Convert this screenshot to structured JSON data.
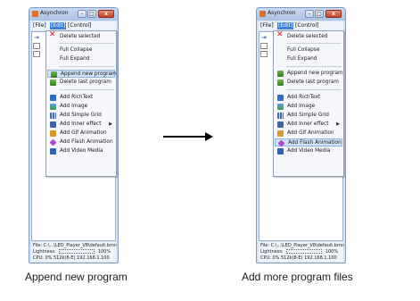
{
  "windows": [
    {
      "title": "Asynchron",
      "menu": {
        "file": "[File]",
        "edit": "[Edit]",
        "control": "[Control]"
      },
      "highlighted_item": "Append new program",
      "status": {
        "file_label": "File:",
        "file_path": "C:\\...\\LED_Player_V8\\default.bmn",
        "lightness_label": "Lightness:",
        "lightness_value": "100%",
        "cpu_label": "CPU:",
        "cpu_value": "0%",
        "mem": "512k(8-E)",
        "ip": "192.168.1.100"
      }
    },
    {
      "title": "Asynchron",
      "menu": {
        "file": "[File]",
        "edit": "[Edit]",
        "control": "[Control]"
      },
      "highlighted_item": "Add Flash Animation",
      "status": {
        "file_label": "File:",
        "file_path": "C:\\...\\LED_Player_V8\\default.bmn",
        "lightness_label": "Lightness:",
        "lightness_value": "100%",
        "cpu_label": "CPU:",
        "cpu_value": "0%",
        "mem": "512k(8-E)",
        "ip": "192.168.1.100"
      }
    }
  ],
  "edit_menu_items": [
    {
      "label": "Delete selected",
      "icon": "delete-x-icon"
    },
    {
      "label": "Full Collapse",
      "icon": ""
    },
    {
      "label": "Full Expand",
      "icon": ""
    },
    {
      "label": "Append new program",
      "icon": "program-icon"
    },
    {
      "label": "Delete last program",
      "icon": "delete-program-icon"
    },
    {
      "label": "Add RichText",
      "icon": "richtext-icon"
    },
    {
      "label": "Add Image",
      "icon": "image-icon"
    },
    {
      "label": "Add Simple Grid",
      "icon": "grid-icon"
    },
    {
      "label": "Add Inner effect",
      "icon": "effect-icon",
      "submenu": true
    },
    {
      "label": "Add Gif Animation",
      "icon": "gif-icon"
    },
    {
      "label": "Add Flash Animation",
      "icon": "flash-icon"
    },
    {
      "label": "Add Video Media",
      "icon": "video-icon"
    }
  ],
  "captions": {
    "left": "Append new program",
    "right": "Add more program files"
  }
}
